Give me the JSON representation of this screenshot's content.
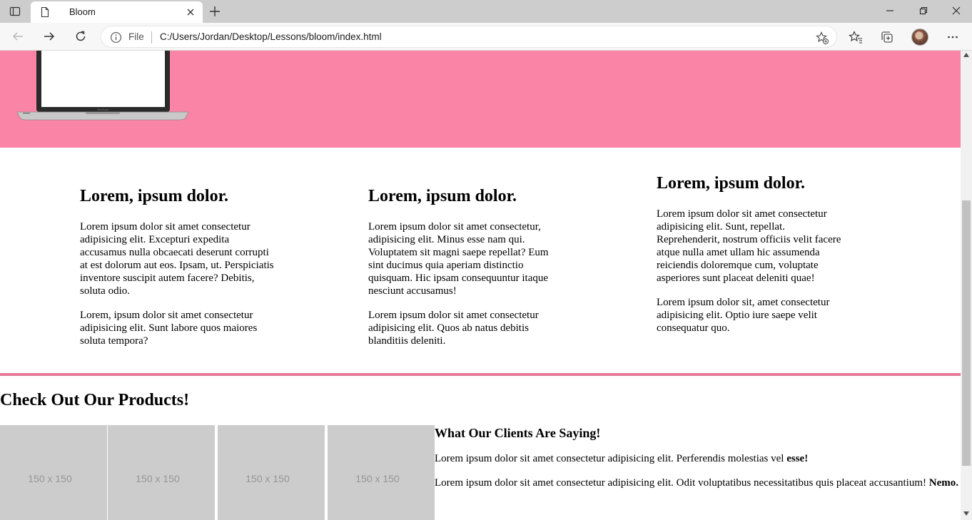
{
  "browser": {
    "tab_title": "Bloom",
    "address_prefix": "File",
    "url": "C:/Users/Jordan/Desktop/Lessons/bloom/index.html",
    "accent_pink": "#fa84a6",
    "rule_pink": "#e47a98"
  },
  "features": [
    {
      "heading": "Lorem, ipsum dolor.",
      "p1": "Lorem ipsum dolor sit amet consectetur adipisicing elit. Excepturi expedita accusamus nulla obcaecati deserunt corrupti at est dolorum aut eos. Ipsam, ut. Perspiciatis inventore suscipit autem facere? Debitis, soluta odio.",
      "p2": "Lorem, ipsum dolor sit amet consectetur adipisicing elit. Sunt labore quos maiores soluta tempora?"
    },
    {
      "heading": "Lorem, ipsum dolor.",
      "p1": "Lorem ipsum dolor sit amet consectetur, adipisicing elit. Minus esse nam qui. Voluptatem sit magni saepe repellat? Eum sint ducimus quia aperiam distinctio quisquam. Hic ipsam consequuntur itaque nesciunt accusamus!",
      "p2": "Lorem ipsum dolor sit amet consectetur adipisicing elit. Quos ab natus debitis blanditiis deleniti."
    },
    {
      "heading": "Lorem, ipsum dolor.",
      "p1": "Lorem ipsum dolor sit amet consectetur adipisicing elit. Sunt, repellat. Reprehenderit, nostrum officiis velit facere atque nulla amet ullam hic assumenda reiciendis doloremque cum, voluptate asperiores sunt placeat deleniti quae!",
      "p2": "Lorem ipsum dolor sit, amet consectetur adipisicing elit. Optio iure saepe velit consequatur quo."
    }
  ],
  "products": {
    "title": "Check Out Our Products!",
    "thumbnails": [
      "150 x 150",
      "150 x 150",
      "150 x 150",
      "150 x 150"
    ]
  },
  "clients": {
    "heading": "What Our Clients Are Saying!",
    "quotes": [
      {
        "text": "Lorem ipsum dolor sit amet consectetur adipisicing elit. Perferendis molestias vel ",
        "name": "esse!"
      },
      {
        "text": "Lorem ipsum dolor sit amet consectetur adipisicing elit. Odit voluptatibus necessitatibus quis placeat accusantium! ",
        "name": "Nemo."
      }
    ]
  },
  "icons": [
    "tab-actions-icon",
    "page-icon",
    "close-icon",
    "plus-icon",
    "minimize-icon",
    "restore-icon",
    "window-close-icon",
    "back-arrow-icon",
    "forward-arrow-icon",
    "reload-icon",
    "info-icon",
    "add-favorite-icon",
    "favorites-icon",
    "collections-icon",
    "more-icon"
  ]
}
